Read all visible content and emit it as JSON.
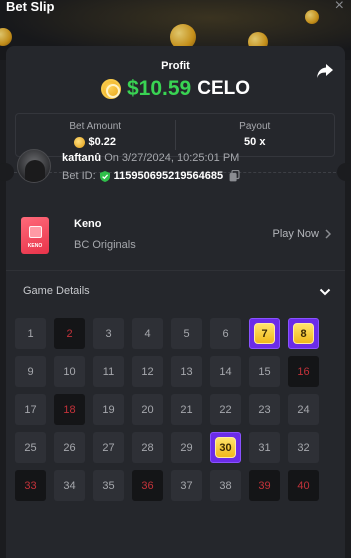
{
  "window": {
    "title": "Bet Slip",
    "close_glyph": "×"
  },
  "profit": {
    "label": "Profit",
    "amount": "$10.59",
    "currency": "CELO"
  },
  "stats": {
    "bet_amount_label": "Bet Amount",
    "bet_amount_value": "$0.22",
    "payout_label": "Payout",
    "payout_value": "50 x"
  },
  "player": {
    "name": "kaftanû",
    "timestamp": "On 3/27/2024, 10:25:01 PM",
    "bet_id_label": "Bet ID:",
    "bet_id_value": "115950695219564685"
  },
  "game": {
    "name": "Keno",
    "provider": "BC Originals",
    "thumb_text": "KENO",
    "play_now_label": "Play Now"
  },
  "details": {
    "header": "Game Details"
  },
  "board": {
    "cells": [
      {
        "n": "1",
        "s": "idle"
      },
      {
        "n": "2",
        "s": "miss"
      },
      {
        "n": "3",
        "s": "idle"
      },
      {
        "n": "4",
        "s": "idle"
      },
      {
        "n": "5",
        "s": "idle"
      },
      {
        "n": "6",
        "s": "idle"
      },
      {
        "n": "7",
        "s": "hit"
      },
      {
        "n": "8",
        "s": "hit"
      },
      {
        "n": "9",
        "s": "idle"
      },
      {
        "n": "10",
        "s": "idle"
      },
      {
        "n": "11",
        "s": "idle"
      },
      {
        "n": "12",
        "s": "idle"
      },
      {
        "n": "13",
        "s": "idle"
      },
      {
        "n": "14",
        "s": "idle"
      },
      {
        "n": "15",
        "s": "idle"
      },
      {
        "n": "16",
        "s": "miss"
      },
      {
        "n": "17",
        "s": "idle"
      },
      {
        "n": "18",
        "s": "miss"
      },
      {
        "n": "19",
        "s": "idle"
      },
      {
        "n": "20",
        "s": "idle"
      },
      {
        "n": "21",
        "s": "idle"
      },
      {
        "n": "22",
        "s": "idle"
      },
      {
        "n": "23",
        "s": "idle"
      },
      {
        "n": "24",
        "s": "idle"
      },
      {
        "n": "25",
        "s": "idle"
      },
      {
        "n": "26",
        "s": "idle"
      },
      {
        "n": "27",
        "s": "idle"
      },
      {
        "n": "28",
        "s": "idle"
      },
      {
        "n": "29",
        "s": "idle"
      },
      {
        "n": "30",
        "s": "hit"
      },
      {
        "n": "31",
        "s": "idle"
      },
      {
        "n": "32",
        "s": "idle"
      },
      {
        "n": "33",
        "s": "miss"
      },
      {
        "n": "34",
        "s": "idle"
      },
      {
        "n": "35",
        "s": "idle"
      },
      {
        "n": "36",
        "s": "miss"
      },
      {
        "n": "37",
        "s": "idle"
      },
      {
        "n": "38",
        "s": "idle"
      },
      {
        "n": "39",
        "s": "miss"
      },
      {
        "n": "40",
        "s": "miss"
      }
    ]
  },
  "icons": {
    "profit_coin": "celo-coin-icon",
    "bet_coin": "coin-icon",
    "share": "share-icon",
    "verified": "shield-check-icon",
    "copy": "copy-icon",
    "chevron_right": "chevron-right-icon",
    "chevron_down": "chevron-down-icon"
  },
  "colors": {
    "profit_green": "#39d353",
    "hit_purple": "#6b2ce8",
    "miss_red": "#c3323a",
    "gem_gold": "#f0b81c"
  }
}
